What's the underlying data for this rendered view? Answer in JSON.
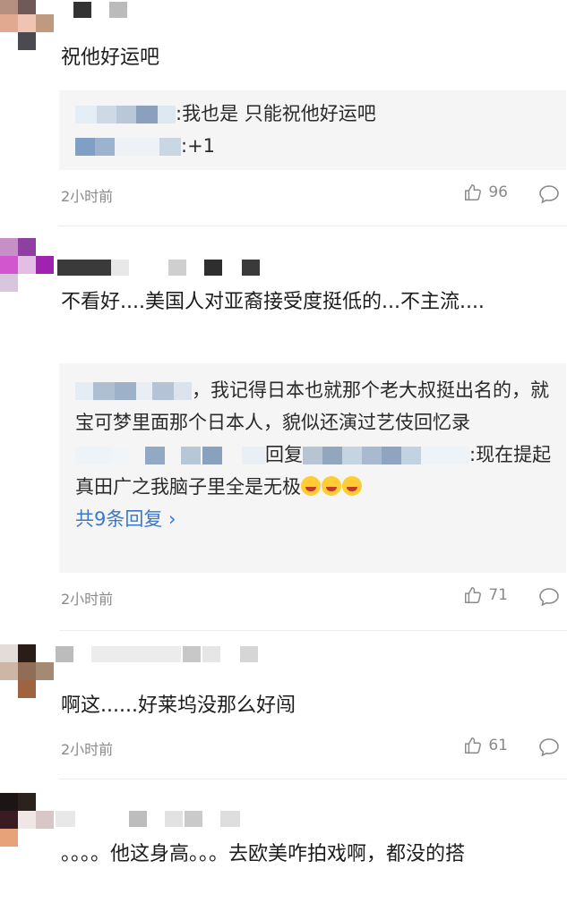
{
  "comments": [
    {
      "content": "祝他好运吧",
      "replies": [
        {
          "text": ":我也是 只能祝他好运吧"
        },
        {
          "text": ":+1"
        }
      ],
      "time": "2小时前",
      "likes": "96"
    },
    {
      "content": "不看好....美国人对亚裔接受度挺低的...不主流....",
      "replies": [
        {
          "text": "，我记得日本也就那个老大叔挺出名的，就宝可梦里面那个日本人，貌似还演过艺伎回忆录"
        },
        {
          "text_mid": "回复",
          "text": ":现在提起真田广之我脑子里全是无极"
        }
      ],
      "more_replies": "共9条回复",
      "time": "2小时前",
      "likes": "71"
    },
    {
      "content": "啊这......好莱坞没那么好闯",
      "time": "2小时前",
      "likes": "61"
    },
    {
      "content": "。。。。他这身高。。。去欧美咋拍戏啊，都没的搭"
    }
  ],
  "icons": {
    "like": "thumbs-up-icon",
    "reply": "comment-bubble-icon",
    "more": "chevron-right-icon",
    "emoji": "laughing-crying-emoji"
  }
}
